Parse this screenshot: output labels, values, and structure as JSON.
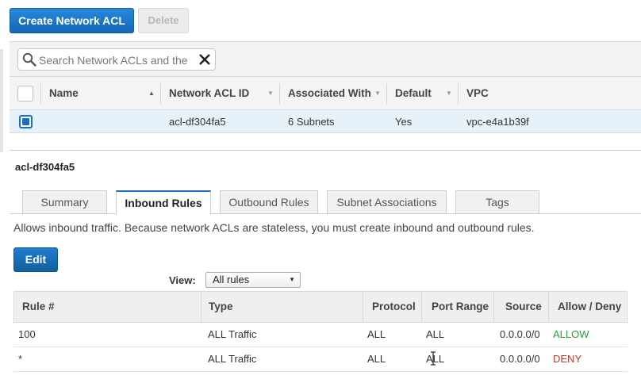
{
  "toolbar": {
    "create_label": "Create Network ACL",
    "delete_label": "Delete"
  },
  "search": {
    "placeholder": "Search Network ACLs and the"
  },
  "grid": {
    "columns": {
      "name": "Name",
      "acl_id": "Network ACL ID",
      "associated": "Associated With",
      "default": "Default",
      "vpc": "VPC"
    },
    "rows": [
      {
        "name": "",
        "acl_id": "acl-df304fa5",
        "associated": "6 Subnets",
        "default": "Yes",
        "vpc": "vpc-e4a1b39f",
        "selected": true
      }
    ]
  },
  "detail": {
    "title": "acl-df304fa5",
    "tabs": [
      "Summary",
      "Inbound Rules",
      "Outbound Rules",
      "Subnet Associations",
      "Tags"
    ],
    "active_tab": "Inbound Rules",
    "description": "Allows inbound traffic. Because network ACLs are stateless, you must create inbound and outbound rules.",
    "edit_label": "Edit",
    "view_label": "View:",
    "view_value": "All rules"
  },
  "rules": {
    "columns": {
      "rule": "Rule #",
      "type": "Type",
      "protocol": "Protocol",
      "port_range": "Port Range",
      "source": "Source",
      "allow_deny": "Allow / Deny"
    },
    "rows": [
      {
        "rule": "100",
        "type": "ALL Traffic",
        "protocol": "ALL",
        "port_range": "ALL",
        "source": "0.0.0.0/0",
        "allow_deny": "ALLOW"
      },
      {
        "rule": "*",
        "type": "ALL Traffic",
        "protocol": "ALL",
        "port_range": "ALL",
        "source": "0.0.0.0/0",
        "allow_deny": "DENY"
      }
    ]
  },
  "colors": {
    "primary": "#1a6fc4",
    "allow": "#2e9c3f",
    "deny": "#c0392b",
    "selected_row": "#e6f1fa"
  }
}
